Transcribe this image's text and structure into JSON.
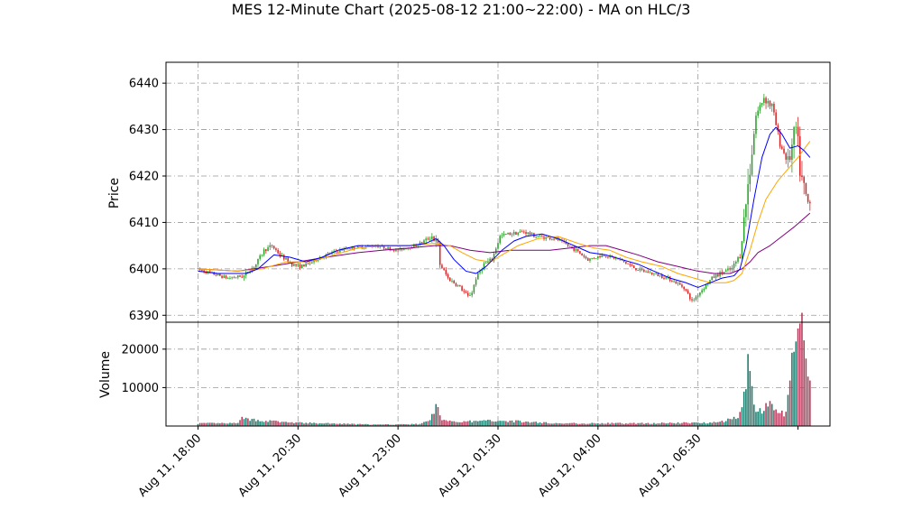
{
  "chart_data": {
    "type": "candlestick",
    "title": "MES 12-Minute Chart (2025-08-12 21:00~22:00) - MA on HLC/3",
    "price_panel": {
      "ylabel": "Price",
      "ylim": [
        6388.5,
        6444.5
      ],
      "yticks": [
        "6390",
        "6400",
        "6410",
        "6420",
        "6430",
        "6440"
      ],
      "grid": true
    },
    "volume_panel": {
      "ylabel": "Volume",
      "ylim": [
        0,
        27000
      ],
      "yticks": [
        "10000",
        "20000"
      ],
      "grid": true
    },
    "xaxis": {
      "tick_labels": [
        "Aug 11, 18:00",
        "Aug 11, 20:30",
        "Aug 11, 23:00",
        "Aug 12, 01:30",
        "Aug 12, 04:00",
        "Aug 12, 06:30"
      ],
      "tick_positions_hours": [
        0,
        2.5,
        5,
        7.5,
        10,
        12.5
      ],
      "xlim_hours": [
        -0.8,
        15.8
      ],
      "extra_tick_hours": 15.0
    },
    "price_anchors": [
      [
        0,
        6400
      ],
      [
        0.4,
        6399
      ],
      [
        0.8,
        6398
      ],
      [
        1.2,
        6398.5
      ],
      [
        1.5,
        6401
      ],
      [
        1.7,
        6404
      ],
      [
        1.9,
        6405
      ],
      [
        2.1,
        6403
      ],
      [
        2.4,
        6401
      ],
      [
        2.6,
        6400.5
      ],
      [
        2.8,
        6401
      ],
      [
        3.0,
        6402
      ],
      [
        3.4,
        6403.5
      ],
      [
        3.8,
        6404.5
      ],
      [
        4.5,
        6405
      ],
      [
        5.0,
        6404
      ],
      [
        5.5,
        6405
      ],
      [
        5.9,
        6407
      ],
      [
        6.05,
        6405
      ],
      [
        6.1,
        6401
      ],
      [
        6.3,
        6398
      ],
      [
        6.6,
        6396
      ],
      [
        6.8,
        6394
      ],
      [
        6.9,
        6395
      ],
      [
        7.0,
        6398
      ],
      [
        7.2,
        6401
      ],
      [
        7.4,
        6402
      ],
      [
        7.6,
        6407
      ],
      [
        7.8,
        6407.5
      ],
      [
        8.2,
        6408
      ],
      [
        8.5,
        6407
      ],
      [
        9.0,
        6406.5
      ],
      [
        9.5,
        6404
      ],
      [
        9.8,
        6402
      ],
      [
        10.2,
        6403
      ],
      [
        10.6,
        6402
      ],
      [
        11.0,
        6400
      ],
      [
        11.4,
        6399
      ],
      [
        11.8,
        6398
      ],
      [
        12.2,
        6396
      ],
      [
        12.4,
        6393
      ],
      [
        12.6,
        6395
      ],
      [
        12.9,
        6398
      ],
      [
        13.1,
        6399
      ],
      [
        13.4,
        6400
      ],
      [
        13.6,
        6403
      ],
      [
        13.8,
        6418
      ],
      [
        14.0,
        6433
      ],
      [
        14.2,
        6437
      ],
      [
        14.4,
        6435
      ],
      [
        14.6,
        6427
      ],
      [
        14.8,
        6423
      ],
      [
        14.9,
        6426
      ],
      [
        15.0,
        6430
      ],
      [
        15.05,
        6426
      ],
      [
        15.12,
        6420
      ],
      [
        15.22,
        6416
      ],
      [
        15.3,
        6414
      ]
    ],
    "ma_fast": [
      [
        0,
        6399.5
      ],
      [
        0.5,
        6399
      ],
      [
        1.2,
        6399
      ],
      [
        1.5,
        6400
      ],
      [
        1.9,
        6403
      ],
      [
        2.3,
        6402.5
      ],
      [
        2.7,
        6401.5
      ],
      [
        3.1,
        6402.5
      ],
      [
        3.5,
        6404
      ],
      [
        4.0,
        6405
      ],
      [
        4.6,
        6405
      ],
      [
        5.3,
        6405
      ],
      [
        5.7,
        6405.5
      ],
      [
        5.95,
        6406.5
      ],
      [
        6.15,
        6405
      ],
      [
        6.4,
        6402
      ],
      [
        6.7,
        6399.5
      ],
      [
        6.95,
        6399
      ],
      [
        7.2,
        6400.5
      ],
      [
        7.6,
        6404
      ],
      [
        7.9,
        6406
      ],
      [
        8.2,
        6407
      ],
      [
        8.6,
        6407.5
      ],
      [
        9.0,
        6406.5
      ],
      [
        9.4,
        6405
      ],
      [
        9.8,
        6403.5
      ],
      [
        10.2,
        6403
      ],
      [
        10.6,
        6402
      ],
      [
        11.0,
        6401
      ],
      [
        11.4,
        6399.5
      ],
      [
        11.8,
        6398
      ],
      [
        12.2,
        6397
      ],
      [
        12.5,
        6396
      ],
      [
        12.8,
        6397
      ],
      [
        13.1,
        6398
      ],
      [
        13.4,
        6398.5
      ],
      [
        13.55,
        6400
      ],
      [
        13.7,
        6405
      ],
      [
        13.9,
        6415
      ],
      [
        14.1,
        6424
      ],
      [
        14.3,
        6429
      ],
      [
        14.45,
        6430.5
      ],
      [
        14.6,
        6429
      ],
      [
        14.8,
        6426
      ],
      [
        15.0,
        6426.5
      ],
      [
        15.15,
        6425.5
      ],
      [
        15.3,
        6424
      ]
    ],
    "ma_mid": [
      [
        0,
        6400
      ],
      [
        1.0,
        6399.5
      ],
      [
        1.6,
        6400
      ],
      [
        2.2,
        6401.5
      ],
      [
        2.8,
        6401.5
      ],
      [
        3.4,
        6403
      ],
      [
        4.0,
        6404.5
      ],
      [
        4.6,
        6405
      ],
      [
        5.3,
        6405
      ],
      [
        5.9,
        6405.5
      ],
      [
        6.3,
        6405
      ],
      [
        6.6,
        6403.5
      ],
      [
        6.95,
        6402
      ],
      [
        7.3,
        6401.5
      ],
      [
        7.6,
        6403
      ],
      [
        8.0,
        6405
      ],
      [
        8.5,
        6406.5
      ],
      [
        9.0,
        6407
      ],
      [
        9.5,
        6405.5
      ],
      [
        9.9,
        6404.5
      ],
      [
        10.3,
        6404
      ],
      [
        10.7,
        6402.5
      ],
      [
        11.1,
        6401.5
      ],
      [
        11.6,
        6400.5
      ],
      [
        12.0,
        6399
      ],
      [
        12.4,
        6398
      ],
      [
        12.8,
        6397
      ],
      [
        13.2,
        6397
      ],
      [
        13.4,
        6397.5
      ],
      [
        13.6,
        6399
      ],
      [
        13.8,
        6404
      ],
      [
        14.0,
        6410
      ],
      [
        14.2,
        6415
      ],
      [
        14.5,
        6419
      ],
      [
        14.8,
        6422
      ],
      [
        15.0,
        6424
      ],
      [
        15.3,
        6427.5
      ]
    ],
    "ma_slow": [
      [
        0,
        6400
      ],
      [
        1.0,
        6399.5
      ],
      [
        1.8,
        6400.5
      ],
      [
        2.5,
        6401.5
      ],
      [
        3.2,
        6402.5
      ],
      [
        4.0,
        6403.5
      ],
      [
        4.6,
        6404
      ],
      [
        5.3,
        6404.5
      ],
      [
        5.9,
        6405
      ],
      [
        6.3,
        6405
      ],
      [
        6.8,
        6404
      ],
      [
        7.3,
        6403.5
      ],
      [
        7.8,
        6404
      ],
      [
        8.3,
        6404
      ],
      [
        8.8,
        6404
      ],
      [
        9.3,
        6404.5
      ],
      [
        9.8,
        6405
      ],
      [
        10.2,
        6405
      ],
      [
        10.6,
        6404
      ],
      [
        11.0,
        6403
      ],
      [
        11.5,
        6401.5
      ],
      [
        12.0,
        6400.5
      ],
      [
        12.5,
        6399.5
      ],
      [
        12.9,
        6399
      ],
      [
        13.3,
        6399
      ],
      [
        13.6,
        6400
      ],
      [
        13.8,
        6401.5
      ],
      [
        14.0,
        6403.5
      ],
      [
        14.3,
        6405
      ],
      [
        14.6,
        6407
      ],
      [
        14.9,
        6409
      ],
      [
        15.1,
        6410.5
      ],
      [
        15.3,
        6412
      ]
    ],
    "volume_profile": [
      [
        0,
        700
      ],
      [
        1.0,
        700
      ],
      [
        1.02,
        2000
      ],
      [
        1.5,
        1500
      ],
      [
        2.3,
        900
      ],
      [
        4.5,
        350
      ],
      [
        5.5,
        500
      ],
      [
        5.8,
        1300
      ],
      [
        5.95,
        5500
      ],
      [
        6.1,
        1500
      ],
      [
        6.6,
        1200
      ],
      [
        7.0,
        1200
      ],
      [
        7.4,
        1500
      ],
      [
        8.0,
        1200
      ],
      [
        9.0,
        700
      ],
      [
        10.0,
        700
      ],
      [
        11.0,
        700
      ],
      [
        12.0,
        800
      ],
      [
        12.8,
        900
      ],
      [
        13.2,
        1400
      ],
      [
        13.5,
        2500
      ],
      [
        13.6,
        5000
      ],
      [
        13.75,
        16000
      ],
      [
        13.9,
        4500
      ],
      [
        14.1,
        3500
      ],
      [
        14.3,
        6500
      ],
      [
        14.5,
        3500
      ],
      [
        14.7,
        3000
      ],
      [
        14.85,
        17000
      ],
      [
        15.0,
        22000
      ],
      [
        15.1,
        24500
      ],
      [
        15.2,
        15000
      ],
      [
        15.3,
        10000
      ]
    ],
    "bar_interval_hours": 0.05,
    "colors": {
      "up": "#2ca02c",
      "down": "#d62728",
      "volume_up": "#1a7a6c",
      "volume_down": "#b33a5a",
      "ma_fast": "#0000ff",
      "ma_mid": "#ffa500",
      "ma_slow": "#800080",
      "grid": "#999999"
    }
  }
}
